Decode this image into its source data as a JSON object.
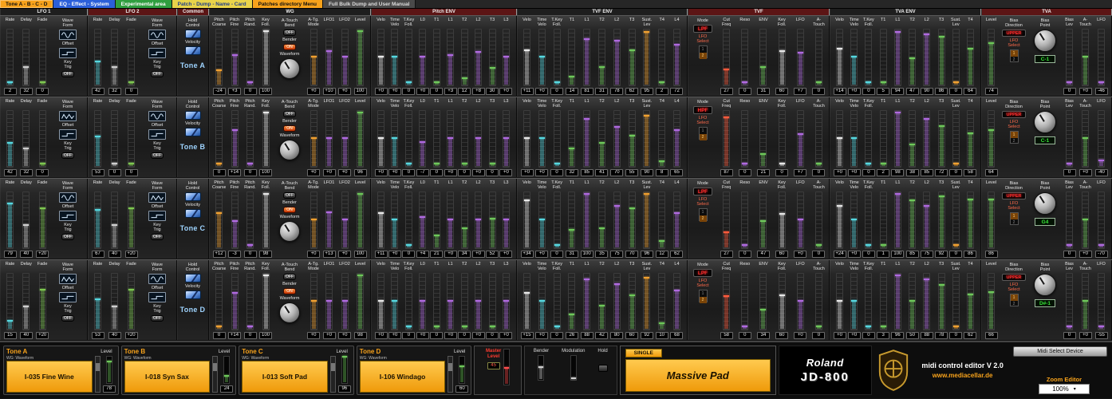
{
  "tabs": [
    {
      "label": "Tone A - B - C - D",
      "bg": "#f7a21b",
      "fg": "#101010",
      "active": true
    },
    {
      "label": "EQ - Effect - System",
      "bg": "#2b5fd9",
      "fg": "#ffffff",
      "active": false
    },
    {
      "label": "Experimental area",
      "bg": "#2f9e3f",
      "fg": "#ffffff",
      "active": false
    },
    {
      "label": "Patch - Dump - Name - Card",
      "bg": "#e9d44a",
      "fg": "#20408a",
      "active": false
    },
    {
      "label": "Patches directory Menu",
      "bg": "#f7a21b",
      "fg": "#101010",
      "active": false
    },
    {
      "label": "Full Bulk Dump and User Manual",
      "bg": "#4a4a4a",
      "fg": "#dddddd",
      "active": false
    }
  ],
  "section_headers": [
    {
      "label": "LFO 1",
      "bg": "#1e1e1e"
    },
    {
      "label": "LFO 2",
      "bg": "#5c1515"
    },
    {
      "label": "Common",
      "bg": "#5c1515"
    },
    {
      "label": "WG",
      "bg": "#1e1e1e"
    },
    {
      "label": "Pitch ENV",
      "bg": "#5c1515"
    },
    {
      "label": "TVF ENV",
      "bg": "#1e1e1e"
    },
    {
      "label": "TVF",
      "bg": "#5c1515"
    },
    {
      "label": "TVA ENV",
      "bg": "#1e1e1e"
    },
    {
      "label": "TVA",
      "bg": "#5c1515"
    }
  ],
  "labels": {
    "wave_form": "Wave Form",
    "offset": "Offset",
    "key_trig": "Key Trig",
    "hold_control": "Hold Control",
    "velocity": "Velocity",
    "atouch_bend": "A-Touch Bend",
    "bender": "Bender",
    "waveform": "Waveform",
    "mode": "Mode",
    "lfo_select": "LFO Select",
    "bias_direction": "Bias Direction",
    "bias_point": "Bias Point",
    "lfo_select_options": [
      "1",
      "2"
    ]
  },
  "defs": {
    "lfo_cols": [
      {
        "l": "Rate",
        "c": "#56d8e0"
      },
      {
        "l": "Delay",
        "c": "#cfcfcf"
      },
      {
        "l": "Fade",
        "c": "#7ec850"
      }
    ],
    "wg_pitch_cols": [
      {
        "l": "Pitch Coarse",
        "c": "#f0a030"
      },
      {
        "l": "Pitch Fine",
        "c": "#b06ae0"
      },
      {
        "l": "Pitch Rand.",
        "c": "#b06ae0"
      },
      {
        "l": "Key Foll.",
        "c": "#e8e8e8"
      }
    ],
    "wg_mod_cols": [
      {
        "l": "A-Tg. Mode",
        "c": "#f0a030"
      },
      {
        "l": "LFO1",
        "c": "#b06ae0"
      },
      {
        "l": "LFO2",
        "c": "#b06ae0"
      },
      {
        "l": "Level",
        "c": "#6ec85a"
      }
    ],
    "pitch_env_cols": [
      {
        "l": "Velo",
        "c": "#e8e8e8"
      },
      {
        "l": "Time Velo",
        "c": "#56d8e0"
      },
      {
        "l": "T.Key Foll.",
        "c": "#56d8e0"
      },
      {
        "l": "L0",
        "c": "#b06ae0"
      },
      {
        "l": "T1",
        "c": "#6ec85a"
      },
      {
        "l": "L1",
        "c": "#b06ae0"
      },
      {
        "l": "T2",
        "c": "#6ec85a"
      },
      {
        "l": "L2",
        "c": "#b06ae0"
      },
      {
        "l": "T3",
        "c": "#6ec85a"
      },
      {
        "l": "L3",
        "c": "#b06ae0"
      }
    ],
    "tvf_env_cols": [
      {
        "l": "Velo",
        "c": "#e8e8e8"
      },
      {
        "l": "Time Velo",
        "c": "#56d8e0"
      },
      {
        "l": "T.Key Foll.",
        "c": "#56d8e0"
      },
      {
        "l": "T1",
        "c": "#6ec85a"
      },
      {
        "l": "L1",
        "c": "#b06ae0"
      },
      {
        "l": "T2",
        "c": "#6ec85a"
      },
      {
        "l": "L2",
        "c": "#b06ae0"
      },
      {
        "l": "T3",
        "c": "#6ec85a"
      },
      {
        "l": "Sust. Lev",
        "c": "#f0a030"
      },
      {
        "l": "T4",
        "c": "#6ec85a"
      },
      {
        "l": "L4",
        "c": "#b06ae0"
      }
    ],
    "tvf_cols": [
      {
        "l": "Cut Freq",
        "c": "#ff5a3c"
      },
      {
        "l": "Reso",
        "c": "#b06ae0"
      },
      {
        "l": "ENV",
        "c": "#6ec85a"
      },
      {
        "l": "Key Foll.",
        "c": "#e8e8e8"
      },
      {
        "l": "LFO",
        "c": "#b06ae0"
      },
      {
        "l": "A- Touch",
        "c": "#6ec85a"
      }
    ],
    "tva_env_cols": [
      {
        "l": "Velo",
        "c": "#e8e8e8"
      },
      {
        "l": "Time Velo",
        "c": "#56d8e0"
      },
      {
        "l": "T.Key Foll.",
        "c": "#56d8e0"
      },
      {
        "l": "T1",
        "c": "#6ec85a"
      },
      {
        "l": "L1",
        "c": "#b06ae0"
      },
      {
        "l": "T2",
        "c": "#6ec85a"
      },
      {
        "l": "L2",
        "c": "#b06ae0"
      },
      {
        "l": "T3",
        "c": "#6ec85a"
      },
      {
        "l": "Sust. Lev",
        "c": "#f0a030"
      },
      {
        "l": "T4",
        "c": "#6ec85a"
      }
    ],
    "tva_cols": [
      {
        "l": "Bias Lev",
        "c": "#b06ae0"
      },
      {
        "l": "A- Touch",
        "c": "#6ec85a"
      },
      {
        "l": "LFO",
        "c": "#b06ae0"
      }
    ],
    "tva_level_col": {
      "l": "Level",
      "c": "#6ec85a"
    }
  },
  "tones": [
    {
      "id": "a",
      "label": "Tone A",
      "lfo1": {
        "values": [
          "2",
          "32",
          "0"
        ],
        "wave": "sine",
        "key_trig": "OFF"
      },
      "lfo2": {
        "values": [
          "42",
          "32",
          "0"
        ],
        "wave": "sine",
        "key_trig": "OFF"
      },
      "wg": {
        "pitch": [
          "-24",
          "+3",
          "0",
          "100"
        ],
        "atouch_bend": "OFF",
        "bender": "ON",
        "mod": [
          "+0",
          "+10",
          "+0",
          "100"
        ]
      },
      "pitch_env": [
        "+0",
        "+0",
        "0",
        "+0",
        "0",
        "+3",
        "12",
        "+8",
        "30",
        "+0"
      ],
      "tvf": {
        "mode": "LPF",
        "lfo_select": "2",
        "values": [
          "27",
          "0",
          "31",
          "60",
          "+7",
          "0"
        ]
      },
      "tvf_env": [
        "+11",
        "+0",
        "0",
        "14",
        "81",
        "31",
        "78",
        "62",
        "95",
        "2",
        "72"
      ],
      "tva_env": [
        "+14",
        "+0",
        "0",
        "5",
        "94",
        "47",
        "90",
        "86",
        "0",
        "64"
      ],
      "tva": {
        "level": "74",
        "bias_direction": "UPPER",
        "lfo_select": "1",
        "bias_point": "C-1",
        "values": [
          "0",
          "+0",
          "-46"
        ]
      }
    },
    {
      "id": "b",
      "label": "Tone B",
      "lfo1": {
        "values": [
          "42",
          "32",
          "0"
        ],
        "wave": "triangle",
        "key_trig": "OFF"
      },
      "lfo2": {
        "values": [
          "53",
          "0",
          "0"
        ],
        "wave": "sine",
        "key_trig": "OFF"
      },
      "wg": {
        "pitch": [
          "0",
          "+14",
          "0",
          "100"
        ],
        "atouch_bend": "OFF",
        "bender": "ON",
        "mod": [
          "+0",
          "+0",
          "+0",
          "96"
        ]
      },
      "pitch_env": [
        "+0",
        "+0",
        "0",
        "-7",
        "0",
        "+0",
        "0",
        "+0",
        "0",
        "+0"
      ],
      "tvf": {
        "mode": "HPF",
        "lfo_select": "2",
        "values": [
          "87",
          "0",
          "21",
          "0",
          "+7",
          "0"
        ]
      },
      "tvf_env": [
        "+0",
        "+0",
        "0",
        "32",
        "85",
        "41",
        "70",
        "55",
        "90",
        "8",
        "65"
      ],
      "tva_env": [
        "+0",
        "+0",
        "0",
        "2",
        "98",
        "38",
        "85",
        "72",
        "0",
        "58"
      ],
      "tva": {
        "level": "64",
        "bias_direction": "UPPER",
        "lfo_select": "1",
        "bias_point": "C-1",
        "values": [
          "0",
          "+0",
          "-40"
        ]
      }
    },
    {
      "id": "c",
      "label": "Tone C",
      "lfo1": {
        "values": [
          "79",
          "40",
          "+20"
        ],
        "wave": "sine",
        "key_trig": "OFF"
      },
      "lfo2": {
        "values": [
          "67",
          "40",
          "+20"
        ],
        "wave": "triangle",
        "key_trig": "OFF"
      },
      "wg": {
        "pitch": [
          "+12",
          "-3",
          "0",
          "98"
        ],
        "atouch_bend": "OFF",
        "bender": "ON",
        "mod": [
          "+0",
          "+13",
          "+0",
          "100"
        ]
      },
      "pitch_env": [
        "+11",
        "+0",
        "0",
        "+4",
        "21",
        "+0",
        "34",
        "+0",
        "52",
        "+0"
      ],
      "tvf": {
        "mode": "LPF",
        "lfo_select": "2",
        "values": [
          "27",
          "0",
          "47",
          "60",
          "+0",
          "0"
        ]
      },
      "tvf_env": [
        "+34",
        "+0",
        "0",
        "31",
        "100",
        "35",
        "75",
        "70",
        "96",
        "12",
        "62"
      ],
      "tva_env": [
        "+24",
        "+0",
        "0",
        "1",
        "100",
        "85",
        "75",
        "92",
        "0",
        "86"
      ],
      "tva": {
        "level": "86",
        "bias_direction": "UPPER",
        "lfo_select": "1",
        "bias_point": "G4",
        "values": [
          "0",
          "+0",
          "-70"
        ]
      }
    },
    {
      "id": "d",
      "label": "Tone D",
      "lfo1": {
        "values": [
          "15",
          "40",
          "+20"
        ],
        "wave": "triangle",
        "key_trig": "OFF"
      },
      "lfo2": {
        "values": [
          "53",
          "40",
          "+20"
        ],
        "wave": "sine",
        "key_trig": "OFF"
      },
      "wg": {
        "pitch": [
          "0",
          "+14",
          "0",
          "100"
        ],
        "atouch_bend": "OFF",
        "bender": "ON",
        "mod": [
          "+0",
          "+0",
          "+0",
          "98"
        ]
      },
      "pitch_env": [
        "+0",
        "+0",
        "0",
        "+0",
        "0",
        "+0",
        "0",
        "+0",
        "0",
        "+0"
      ],
      "tvf": {
        "mode": "LPF",
        "lfo_select": "2",
        "values": [
          "58",
          "0",
          "34",
          "60",
          "+0",
          "0"
        ]
      },
      "tvf_env": [
        "+15",
        "+0",
        "0",
        "26",
        "88",
        "42",
        "80",
        "60",
        "92",
        "10",
        "68"
      ],
      "tva_env": [
        "+0",
        "+0",
        "0",
        "3",
        "96",
        "50",
        "88",
        "78",
        "0",
        "62"
      ],
      "tva": {
        "level": "66",
        "bias_direction": "UPPER",
        "lfo_select": "1",
        "bias_point": "D#-1",
        "values": [
          "0",
          "+0",
          "-55"
        ]
      }
    }
  ],
  "bottom": {
    "tones": [
      {
        "name": "Tone A",
        "wg_label": "WG: Waveform",
        "waveform": "I-035 Fine Wine",
        "level_label": "Level",
        "level": "78"
      },
      {
        "name": "Tone B",
        "wg_label": "WG: Waveform",
        "waveform": "I-018 Syn Sax",
        "level_label": "Level",
        "level": "24"
      },
      {
        "name": "Tone C",
        "wg_label": "WG: Waveform",
        "waveform": "I-013 Soft Pad",
        "level_label": "Level",
        "level": "96"
      },
      {
        "name": "Tone D",
        "wg_label": "WG: Waveform",
        "waveform": "I-106 Windago",
        "level_label": "Level",
        "level": "60"
      }
    ],
    "master": {
      "label": "Master Level",
      "value": "45"
    },
    "controllers": {
      "bender": "Bender",
      "modulation": "Modulation",
      "hold": "Hold"
    },
    "patch": {
      "mode": "SINGLE",
      "name": "Massive Pad"
    },
    "brand": {
      "roland": "Roland",
      "model": "JD-800",
      "editor": "midi control editor V 2.0",
      "site": "www.mediacellar.de"
    },
    "midi_button": "Midi Select Device",
    "zoom": {
      "label": "Zoom Editor",
      "value": "100%"
    }
  }
}
